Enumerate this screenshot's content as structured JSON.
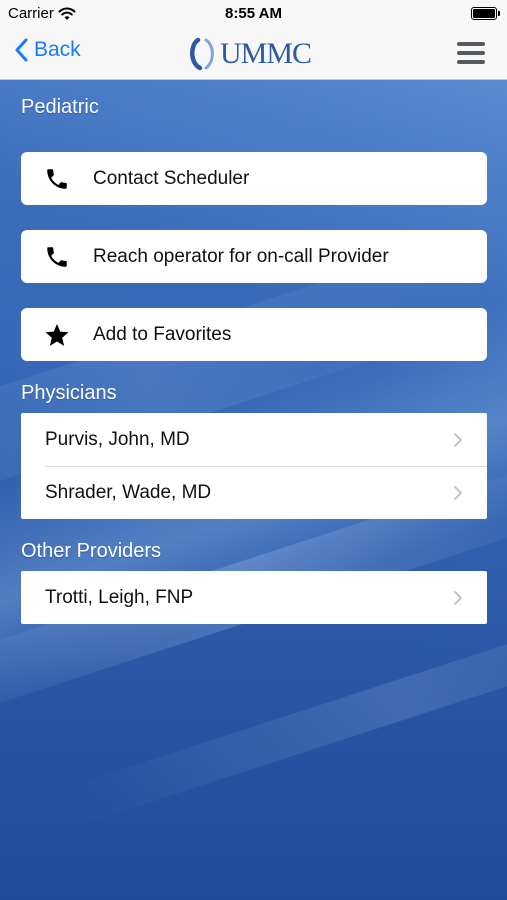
{
  "status_bar": {
    "carrier": "Carrier",
    "time": "8:55 AM"
  },
  "nav": {
    "back_label": "Back",
    "logo_text": "UMMC",
    "accent_color": "#1a7cf5"
  },
  "page": {
    "section_title": "Pediatric",
    "actions": [
      {
        "label": "Contact Scheduler",
        "icon": "phone-icon"
      },
      {
        "label": "Reach operator for on-call Provider",
        "icon": "phone-icon"
      },
      {
        "label": "Add to Favorites",
        "icon": "star-icon"
      }
    ],
    "physicians_header": "Physicians",
    "physicians": [
      {
        "name": "Purvis, John, MD"
      },
      {
        "name": "Shrader, Wade, MD"
      }
    ],
    "other_header": "Other Providers",
    "other_providers": [
      {
        "name": "Trotti, Leigh, FNP"
      }
    ]
  }
}
